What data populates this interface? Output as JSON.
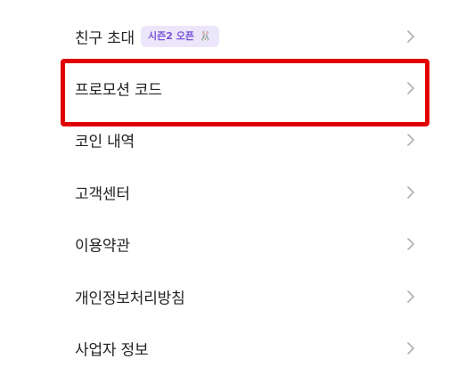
{
  "menu": {
    "items": [
      {
        "label": "친구 초대",
        "badge": "시즌2 오픈"
      },
      {
        "label": "프로모션 코드"
      },
      {
        "label": "코인 내역"
      },
      {
        "label": "고객센터"
      },
      {
        "label": "이용약관"
      },
      {
        "label": "개인정보처리방침"
      },
      {
        "label": "사업자 정보"
      }
    ]
  },
  "icons": {
    "row_arrow": "chevron-right-icon",
    "badge_emoji": "rabbit-icon"
  },
  "colors": {
    "highlight": "#e00000",
    "badge_bg": "#ece6fb",
    "badge_text": "#7a55d6",
    "label_text": "#222222",
    "chevron": "#b0b0b0"
  }
}
